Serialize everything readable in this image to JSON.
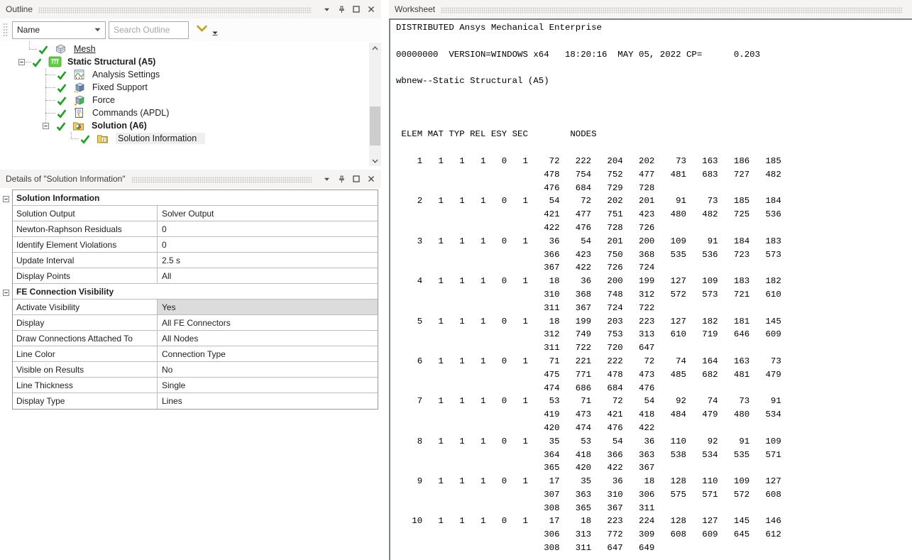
{
  "colors": {
    "accent_gold": "#C89B18",
    "check_green": "#17A317",
    "tree_selection_bg": "#EFEFEF",
    "selected_cell_bg": "#DCDCDC",
    "structural_green": "#5FD13F",
    "folder_yellow": "#F2CE58"
  },
  "outline_panel": {
    "title": "Outline",
    "toolbar": {
      "name_filter_label": "Name",
      "search_placeholder": "Search Outline"
    },
    "tree_items": [
      {
        "label": "Mesh",
        "icon": "mesh-icon",
        "indent": 54,
        "stub": true,
        "underline": true
      },
      {
        "label": "Static Structural (A5)",
        "icon": "static-structural-icon",
        "indent": 26,
        "expand": "minus",
        "bold": true
      },
      {
        "label": "Analysis Settings",
        "icon": "analysis-settings-icon",
        "indent": 80,
        "stub": true
      },
      {
        "label": "Fixed Support",
        "icon": "fixed-support-icon",
        "indent": 80,
        "stub": true
      },
      {
        "label": "Force",
        "icon": "force-icon",
        "indent": 80,
        "stub": true
      },
      {
        "label": "Commands (APDL)",
        "icon": "commands-apdl-icon",
        "indent": 80,
        "stub": true
      },
      {
        "label": "Solution (A6)",
        "icon": "solution-icon",
        "indent": 60,
        "expand": "minus",
        "bold": true
      },
      {
        "label": "Solution Information",
        "icon": "solution-information-icon",
        "indent": 113,
        "stub": true,
        "selected": true
      }
    ]
  },
  "details_panel": {
    "title": "Details of \"Solution Information\"",
    "sections": [
      {
        "title": "Solution Information",
        "rows": [
          {
            "label": "Solution Output",
            "value": "Solver Output"
          },
          {
            "label": "Newton-Raphson Residuals",
            "value": "0"
          },
          {
            "label": "Identify Element Violations",
            "value": "0"
          },
          {
            "label": "Update Interval",
            "value": "2.5 s"
          },
          {
            "label": "Display Points",
            "value": "All"
          }
        ]
      },
      {
        "title": "FE Connection Visibility",
        "rows": [
          {
            "label": "Activate Visibility",
            "value": "Yes",
            "highlighted": true
          },
          {
            "label": "Display",
            "value": "All FE Connectors"
          },
          {
            "label": "Draw Connections Attached To",
            "value": "All Nodes"
          },
          {
            "label": "Line Color",
            "value": "Connection Type"
          },
          {
            "label": "Visible on Results",
            "value": "No"
          },
          {
            "label": "Line Thickness",
            "value": "Single"
          },
          {
            "label": "Display Type",
            "value": "Lines"
          }
        ]
      }
    ]
  },
  "worksheet_panel": {
    "title": "Worksheet",
    "intro_lines": [
      "DISTRIBUTED Ansys Mechanical Enterprise",
      "",
      "00000000  VERSION=WINDOWS x64   18:20:16  MAY 05, 2022 CP=      0.203",
      "",
      "wbnew--Static Structural (A5)",
      "",
      "",
      ""
    ],
    "element_table": {
      "headers": [
        "ELEM",
        "MAT",
        "TYP",
        "REL",
        "ESY",
        "SEC",
        "NODES"
      ],
      "elements": [
        {
          "elem": 1,
          "mat": 1,
          "typ": 1,
          "rel": 1,
          "esy": 0,
          "sec": 1,
          "nodes": [
            [
              72,
              222,
              204,
              202,
              73,
              163,
              186,
              185
            ],
            [
              478,
              754,
              752,
              477,
              481,
              683,
              727,
              482
            ],
            [
              476,
              684,
              729,
              728
            ]
          ]
        },
        {
          "elem": 2,
          "mat": 1,
          "typ": 1,
          "rel": 1,
          "esy": 0,
          "sec": 1,
          "nodes": [
            [
              54,
              72,
              202,
              201,
              91,
              73,
              185,
              184
            ],
            [
              421,
              477,
              751,
              423,
              480,
              482,
              725,
              536
            ],
            [
              422,
              476,
              728,
              726
            ]
          ]
        },
        {
          "elem": 3,
          "mat": 1,
          "typ": 1,
          "rel": 1,
          "esy": 0,
          "sec": 1,
          "nodes": [
            [
              36,
              54,
              201,
              200,
              109,
              91,
              184,
              183
            ],
            [
              366,
              423,
              750,
              368,
              535,
              536,
              723,
              573
            ],
            [
              367,
              422,
              726,
              724
            ]
          ]
        },
        {
          "elem": 4,
          "mat": 1,
          "typ": 1,
          "rel": 1,
          "esy": 0,
          "sec": 1,
          "nodes": [
            [
              18,
              36,
              200,
              199,
              127,
              109,
              183,
              182
            ],
            [
              310,
              368,
              748,
              312,
              572,
              573,
              721,
              610
            ],
            [
              311,
              367,
              724,
              722
            ]
          ]
        },
        {
          "elem": 5,
          "mat": 1,
          "typ": 1,
          "rel": 1,
          "esy": 0,
          "sec": 1,
          "nodes": [
            [
              18,
              199,
              203,
              223,
              127,
              182,
              181,
              145
            ],
            [
              312,
              749,
              753,
              313,
              610,
              719,
              646,
              609
            ],
            [
              311,
              722,
              720,
              647
            ]
          ]
        },
        {
          "elem": 6,
          "mat": 1,
          "typ": 1,
          "rel": 1,
          "esy": 0,
          "sec": 1,
          "nodes": [
            [
              71,
              221,
              222,
              72,
              74,
              164,
              163,
              73
            ],
            [
              475,
              771,
              478,
              473,
              485,
              682,
              481,
              479
            ],
            [
              474,
              686,
              684,
              476
            ]
          ]
        },
        {
          "elem": 7,
          "mat": 1,
          "typ": 1,
          "rel": 1,
          "esy": 0,
          "sec": 1,
          "nodes": [
            [
              53,
              71,
              72,
              54,
              92,
              74,
              73,
              91
            ],
            [
              419,
              473,
              421,
              418,
              484,
              479,
              480,
              534
            ],
            [
              420,
              474,
              476,
              422
            ]
          ]
        },
        {
          "elem": 8,
          "mat": 1,
          "typ": 1,
          "rel": 1,
          "esy": 0,
          "sec": 1,
          "nodes": [
            [
              35,
              53,
              54,
              36,
              110,
              92,
              91,
              109
            ],
            [
              364,
              418,
              366,
              363,
              538,
              534,
              535,
              571
            ],
            [
              365,
              420,
              422,
              367
            ]
          ]
        },
        {
          "elem": 9,
          "mat": 1,
          "typ": 1,
          "rel": 1,
          "esy": 0,
          "sec": 1,
          "nodes": [
            [
              17,
              35,
              36,
              18,
              128,
              110,
              109,
              127
            ],
            [
              307,
              363,
              310,
              306,
              575,
              571,
              572,
              608
            ],
            [
              308,
              365,
              367,
              311
            ]
          ]
        },
        {
          "elem": 10,
          "mat": 1,
          "typ": 1,
          "rel": 1,
          "esy": 0,
          "sec": 1,
          "nodes": [
            [
              17,
              18,
              223,
              224,
              128,
              127,
              145,
              146
            ],
            [
              306,
              313,
              772,
              309,
              608,
              609,
              645,
              612
            ],
            [
              308,
              311,
              647,
              649
            ]
          ]
        }
      ]
    }
  }
}
